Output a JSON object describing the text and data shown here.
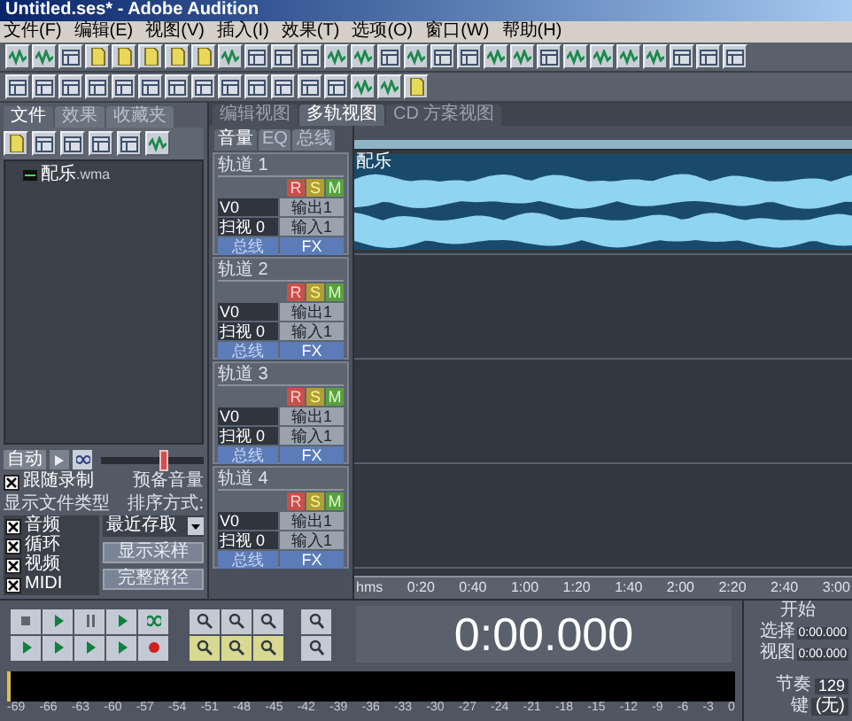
{
  "window": {
    "title": "Untitled.ses* - Adobe Audition"
  },
  "menu": [
    "文件(F)",
    "编辑(E)",
    "视图(V)",
    "插入(I)",
    "效果(T)",
    "选项(O)",
    "窗口(W)",
    "帮助(H)"
  ],
  "left_panel": {
    "tabs": [
      {
        "label": "文件",
        "selected": true
      },
      {
        "label": "效果",
        "selected": false
      },
      {
        "label": "收藏夹",
        "selected": false
      }
    ],
    "files": [
      {
        "name": "配乐",
        "ext": ".wma"
      }
    ],
    "auto_button": "自动",
    "preroll": {
      "label": "预备音量",
      "level": 0.6
    },
    "follow": {
      "label": "跟随录制",
      "checked": true
    },
    "file_types_label": "显示文件类型",
    "sort_label": "排序方式:",
    "sort_value": "最近存取",
    "file_types": [
      {
        "label": "音频",
        "checked": true
      },
      {
        "label": "循环",
        "checked": true
      },
      {
        "label": "视频",
        "checked": true
      },
      {
        "label": "MIDI",
        "checked": true
      }
    ],
    "buttons": [
      "显示采样",
      "完整路径"
    ]
  },
  "view_tabs": [
    {
      "label": "编辑视图",
      "selected": false
    },
    {
      "label": "多轨视图",
      "selected": true
    },
    {
      "label": "CD 方案视图",
      "selected": false
    }
  ],
  "track_tabs": [
    {
      "label": "音量",
      "selected": true
    },
    {
      "label": "EQ",
      "selected": false
    },
    {
      "label": "总线",
      "selected": false
    }
  ],
  "tracks": [
    {
      "name": "轨道 1",
      "rec": "R",
      "solo": "S",
      "mute": "M",
      "volume": "V0",
      "output": "输出1",
      "pan": "扫视 0",
      "input": "输入1",
      "bus": "总线",
      "fx": "FX",
      "clip": "配乐"
    },
    {
      "name": "轨道 2",
      "rec": "R",
      "solo": "S",
      "mute": "M",
      "volume": "V0",
      "output": "输出1",
      "pan": "扫视 0",
      "input": "输入1",
      "bus": "总线",
      "fx": "FX"
    },
    {
      "name": "轨道 3",
      "rec": "R",
      "solo": "S",
      "mute": "M",
      "volume": "V0",
      "output": "输出1",
      "pan": "扫视 0",
      "input": "输入1",
      "bus": "总线",
      "fx": "FX"
    },
    {
      "name": "轨道 4",
      "rec": "R",
      "solo": "S",
      "mute": "M",
      "volume": "V0",
      "output": "输出1",
      "pan": "扫视 0",
      "input": "输入1",
      "bus": "总线",
      "fx": "FX"
    }
  ],
  "ruler": [
    "hms",
    "0:20",
    "0:40",
    "1:00",
    "1:20",
    "1:40",
    "2:00",
    "2:20",
    "2:40",
    "3:00"
  ],
  "time": "0:00.000",
  "info": {
    "header": "开始",
    "rows": [
      {
        "label": "选择",
        "value": "0:00.000"
      },
      {
        "label": "视图",
        "value": "0:00.000"
      }
    ],
    "tempo_label": "节奏",
    "tempo": "129",
    "key_label": "键",
    "key": "(无)"
  },
  "meter_ticks": [
    "-69",
    "-66",
    "-63",
    "-60",
    "-57",
    "-54",
    "-51",
    "-48",
    "-45",
    "-42",
    "-39",
    "-36",
    "-33",
    "-30",
    "-27",
    "-24",
    "-21",
    "-18",
    "-15",
    "-12",
    "-9",
    "-6",
    "-3",
    "0"
  ]
}
